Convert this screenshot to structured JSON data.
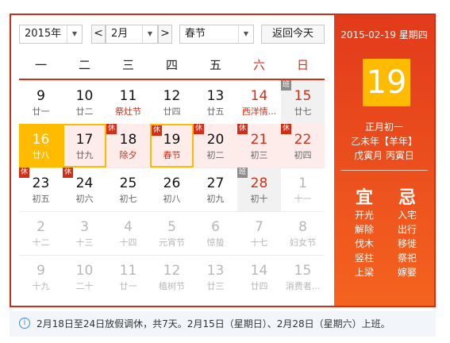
{
  "toolbar": {
    "year": "2015年",
    "month": "2月",
    "holiday": "春节",
    "prev": "<",
    "next": ">",
    "today_button": "返回今天"
  },
  "weekdays": [
    "一",
    "二",
    "三",
    "四",
    "五",
    "六",
    "日"
  ],
  "rest_badge": "休",
  "work_badge": "班",
  "days": [
    {
      "n": "9",
      "l": "廿一"
    },
    {
      "n": "10",
      "l": "廿二"
    },
    {
      "n": "11",
      "l": "祭灶节",
      "lred": true
    },
    {
      "n": "12",
      "l": "廿四"
    },
    {
      "n": "13",
      "l": "廿五"
    },
    {
      "n": "14",
      "l": "西洋情...",
      "red": true,
      "lred": true
    },
    {
      "n": "15",
      "l": "廿七",
      "red": true,
      "work": true
    },
    {
      "n": "16",
      "l": "廿八",
      "selected": true,
      "holiday": true
    },
    {
      "n": "17",
      "l": "廿九",
      "today": true,
      "holiday": true
    },
    {
      "n": "18",
      "l": "除夕",
      "holiday": true,
      "lred": true,
      "rest": true
    },
    {
      "n": "19",
      "l": "春节",
      "holiday": true,
      "lred": true,
      "rest": true,
      "today": true
    },
    {
      "n": "20",
      "l": "初二",
      "holiday": true,
      "rest": true
    },
    {
      "n": "21",
      "l": "初三",
      "holiday": true,
      "rest": true,
      "red": true
    },
    {
      "n": "22",
      "l": "初四",
      "holiday": true,
      "rest": true,
      "red": true
    },
    {
      "n": "23",
      "l": "初五",
      "rest": true
    },
    {
      "n": "24",
      "l": "初六",
      "rest": true
    },
    {
      "n": "25",
      "l": "初七"
    },
    {
      "n": "26",
      "l": "初八"
    },
    {
      "n": "27",
      "l": "初九"
    },
    {
      "n": "28",
      "l": "初十",
      "red": true,
      "work": true
    },
    {
      "n": "1",
      "l": "十一",
      "dim": true
    },
    {
      "n": "2",
      "l": "十二",
      "dim": true
    },
    {
      "n": "3",
      "l": "十三",
      "dim": true
    },
    {
      "n": "4",
      "l": "十四",
      "dim": true
    },
    {
      "n": "5",
      "l": "元宵节",
      "dim": true
    },
    {
      "n": "6",
      "l": "惊蛰",
      "dim": true
    },
    {
      "n": "7",
      "l": "十七",
      "dim": true
    },
    {
      "n": "8",
      "l": "妇女节",
      "dim": true
    },
    {
      "n": "9",
      "l": "十九",
      "dim": true
    },
    {
      "n": "10",
      "l": "二十",
      "dim": true
    },
    {
      "n": "11",
      "l": "廿一",
      "dim": true
    },
    {
      "n": "12",
      "l": "植树节",
      "dim": true
    },
    {
      "n": "13",
      "l": "廿三",
      "dim": true
    },
    {
      "n": "14",
      "l": "廿四",
      "dim": true
    },
    {
      "n": "15",
      "l": "消费者...",
      "dim": true
    }
  ],
  "side": {
    "date": "2015-02-19 星期四",
    "day": "19",
    "lunar1": "正月初一",
    "lunar2": "乙未年【羊年】",
    "lunar3": "戊寅月 丙寅日",
    "yi_title": "宜",
    "ji_title": "忌",
    "yi": [
      "开光",
      "解除",
      "伐木",
      "竖柱",
      "上梁"
    ],
    "ji": [
      "入宅",
      "出行",
      "移徙",
      "祭祀",
      "嫁娶"
    ]
  },
  "footer": {
    "icon": "i",
    "text": "2月18日至24日放假调休，共7天。2月15日（星期日）、2月28日（星期六）上班。"
  }
}
